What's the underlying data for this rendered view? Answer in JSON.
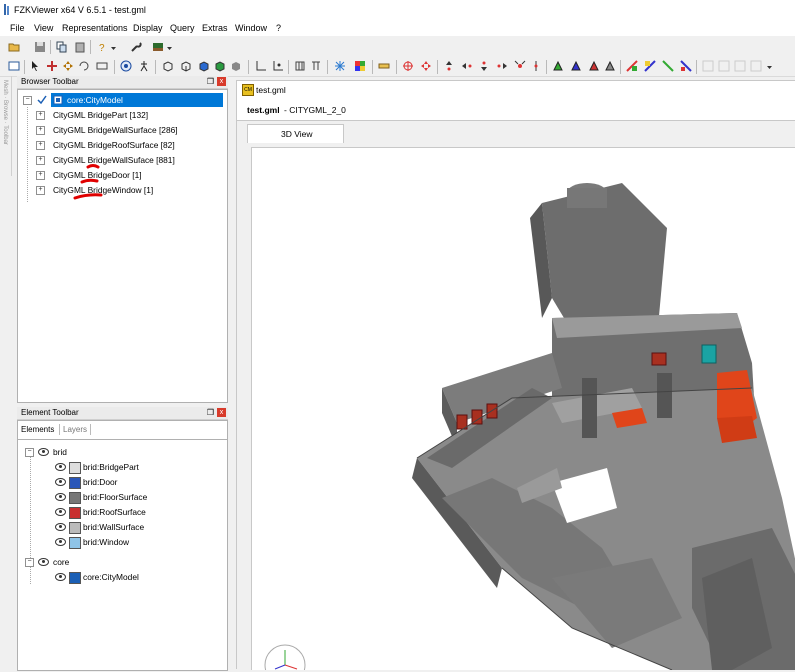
{
  "window": {
    "title": "FZKViewer x64 V 6.5.1 - test.gml"
  },
  "menu": [
    "File",
    "View",
    "Representations",
    "Display",
    "Query",
    "Extras",
    "Window",
    "?"
  ],
  "browser": {
    "title": "Browser Toolbar",
    "pin": "❒",
    "close": "x",
    "root": "core:CityModel",
    "items": [
      "CityGML BridgePart [132]",
      "CityGML BridgeWallSurface [286]",
      "CityGML BridgeRoofSurface [82]",
      "CityGML BridgeWallSuface [881]",
      "CityGML BridgeDoor [1]",
      "CityGML BridgeWindow [1]"
    ]
  },
  "element": {
    "title": "Element Toolbar",
    "tabs": [
      "Elements",
      "Layers"
    ],
    "groups": [
      {
        "name": "brid",
        "items": [
          "brid:BridgePart",
          "brid:Door",
          "brid:FloorSurface",
          "brid:RoofSurface",
          "brid:WallSurface",
          "brid:Window"
        ]
      },
      {
        "name": "core",
        "items": [
          "core:CityModel"
        ]
      }
    ]
  },
  "document": {
    "tab": "test.gml",
    "file": "test.gml",
    "schema": " - CITYGML_2_0",
    "view_tab": "3D View"
  },
  "colors": {
    "accent": "#0078d7",
    "model": "#6e6e6e",
    "stairs": "#e0451a",
    "door": "#1aa3a3",
    "annotation": "#e00000"
  }
}
